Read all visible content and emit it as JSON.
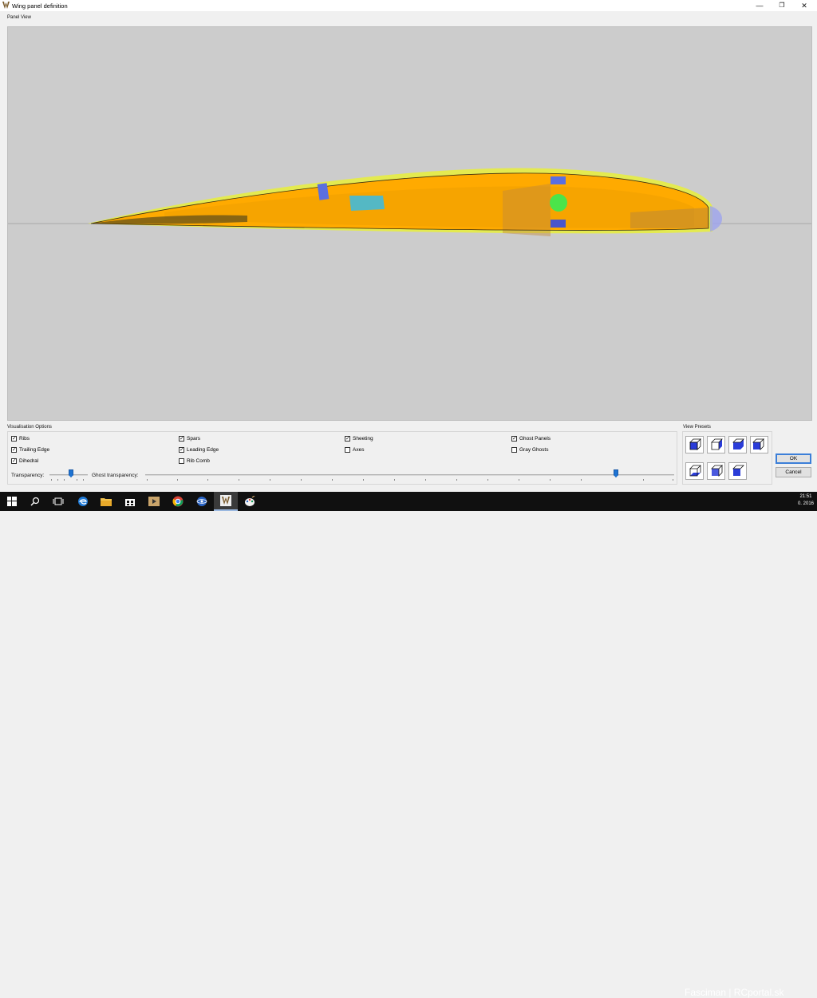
{
  "window": {
    "title": "Wing panel definition",
    "minimize": "—",
    "restore": "❐",
    "close": "✕"
  },
  "panel_view": {
    "label": "Panel View"
  },
  "visualisation": {
    "label": "Visualisation Options",
    "checkboxes": [
      {
        "label": "Ribs",
        "checked": true
      },
      {
        "label": "Trailing Edge",
        "checked": true
      },
      {
        "label": "Dihedral",
        "checked": true
      },
      {
        "label": "Spars",
        "checked": true
      },
      {
        "label": "Leading Edge",
        "checked": true
      },
      {
        "label": "Rib Comb",
        "checked": false
      },
      {
        "label": "Sheeting",
        "checked": true
      },
      {
        "label": "Axes",
        "checked": false
      },
      {
        "label": "Ghost Panels",
        "checked": true
      },
      {
        "label": "Gray Ghosts",
        "checked": false
      }
    ],
    "transparency_label": "Transparency:",
    "ghost_transparency_label": "Ghost transparency:",
    "transparency_level": 0.6,
    "ghost_transparency_level": 0.89
  },
  "view_presets": {
    "label": "View Presets"
  },
  "buttons": {
    "ok": "OK",
    "cancel": "Cancel"
  },
  "taskbar": {
    "items": [
      "start-icon",
      "search-icon",
      "task-view-icon",
      "edge-icon",
      "file-explorer-icon",
      "store-icon",
      "media-icon",
      "chrome-icon",
      "globe-app-icon",
      "wing-app-icon",
      "paint-app-icon"
    ],
    "clock_time": "21:51",
    "clock_date": "0. 2016"
  },
  "watermark": "Fasciman | RCportal.sk",
  "colors": {
    "viewport_bg": "#cccccc",
    "wing_orange": "#ffaa00",
    "wing_yellow": "#e8ef3a",
    "spar_blue": "#5b6fe0",
    "accent_blue": "#1e73d2"
  }
}
